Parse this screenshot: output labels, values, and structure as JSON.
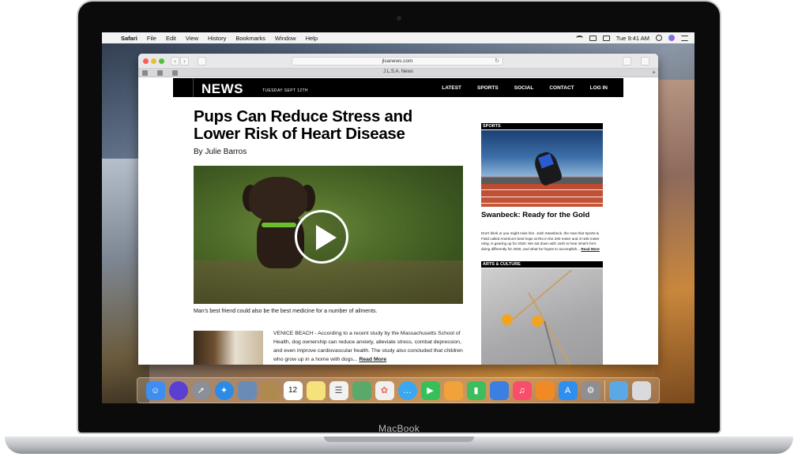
{
  "device": {
    "brand_label": "MacBook"
  },
  "menubar": {
    "apple_glyph": "",
    "items": [
      "Safari",
      "File",
      "Edit",
      "View",
      "History",
      "Bookmarks",
      "Window",
      "Help"
    ],
    "clock": "Tue 9:41 AM"
  },
  "browser": {
    "url": "jlsanews.com",
    "tab_title": "J.L.S.A. News"
  },
  "site": {
    "logo": "NEWS",
    "date": "TUESDAY SEPT 12TH",
    "nav": [
      "LATEST",
      "SPORTS",
      "SOCIAL",
      "CONTACT",
      "LOG IN"
    ]
  },
  "article": {
    "headline": "Pups Can Reduce Stress and Lower Risk of Heart Disease",
    "byline": "By Julie Barros",
    "caption": "Man's best friend could also be the best medicine for a number of ailments.",
    "body": "VENICE BEACH - According to a recent study by the Massachusetts School of Health, dog ownership can reduce anxiety, alleviate stress, combat depression, and even improve cardiovascular health. The study also concluded that children who grow up in a home with dogs...",
    "read_more": "Read More"
  },
  "sidebar": {
    "sports_label": "SPORTS",
    "sports_headline": "Swanbeck: Ready for the Gold",
    "sports_text": "Don't blink or you might miss him. Josh Swanbeck, the man that Sports & Field called America's best hope at Rio in the 200 meter and 4×100 meter relay, is gearing up for 2020. We sat down with Josh to hear what's he's doing differently for 2020, and what he hopes to accomplish...",
    "read_more": "Read More",
    "arts_label": "ARTS & CULTURE"
  },
  "dock": {
    "apps": [
      {
        "name": "finder-icon",
        "color": "#3d8ef0"
      },
      {
        "name": "siri-icon",
        "color": "#5b3fd0"
      },
      {
        "name": "launchpad-icon",
        "color": "#8a8f99"
      },
      {
        "name": "safari-icon",
        "color": "#2b8be6"
      },
      {
        "name": "photos-app-icon",
        "color": "#6a8bb5"
      },
      {
        "name": "contacts-icon",
        "color": "#b0894f"
      },
      {
        "name": "calendar-icon",
        "color": "#ffffff"
      },
      {
        "name": "notes-icon",
        "color": "#f6e27a"
      },
      {
        "name": "reminders-icon",
        "color": "#f2f2f2"
      },
      {
        "name": "maps-icon",
        "color": "#5aa86a"
      },
      {
        "name": "photos-icon",
        "color": "#f0f0f0"
      },
      {
        "name": "messages-icon",
        "color": "#3aa7f0"
      },
      {
        "name": "facetime-icon",
        "color": "#36c05a"
      },
      {
        "name": "pages-icon",
        "color": "#f2a23a"
      },
      {
        "name": "numbers-icon",
        "color": "#3dbd5e"
      },
      {
        "name": "keynote-icon",
        "color": "#3b7fe0"
      },
      {
        "name": "music-icon",
        "color": "#fa4d6d"
      },
      {
        "name": "books-icon",
        "color": "#f08a24"
      },
      {
        "name": "app-store-icon",
        "color": "#2d8ff0"
      },
      {
        "name": "system-preferences-icon",
        "color": "#8e8e93"
      }
    ],
    "after_separator": [
      {
        "name": "downloads-folder-icon",
        "color": "#5aa9e6"
      },
      {
        "name": "trash-icon",
        "color": "#d9dadc"
      }
    ],
    "calendar_day": "12"
  }
}
